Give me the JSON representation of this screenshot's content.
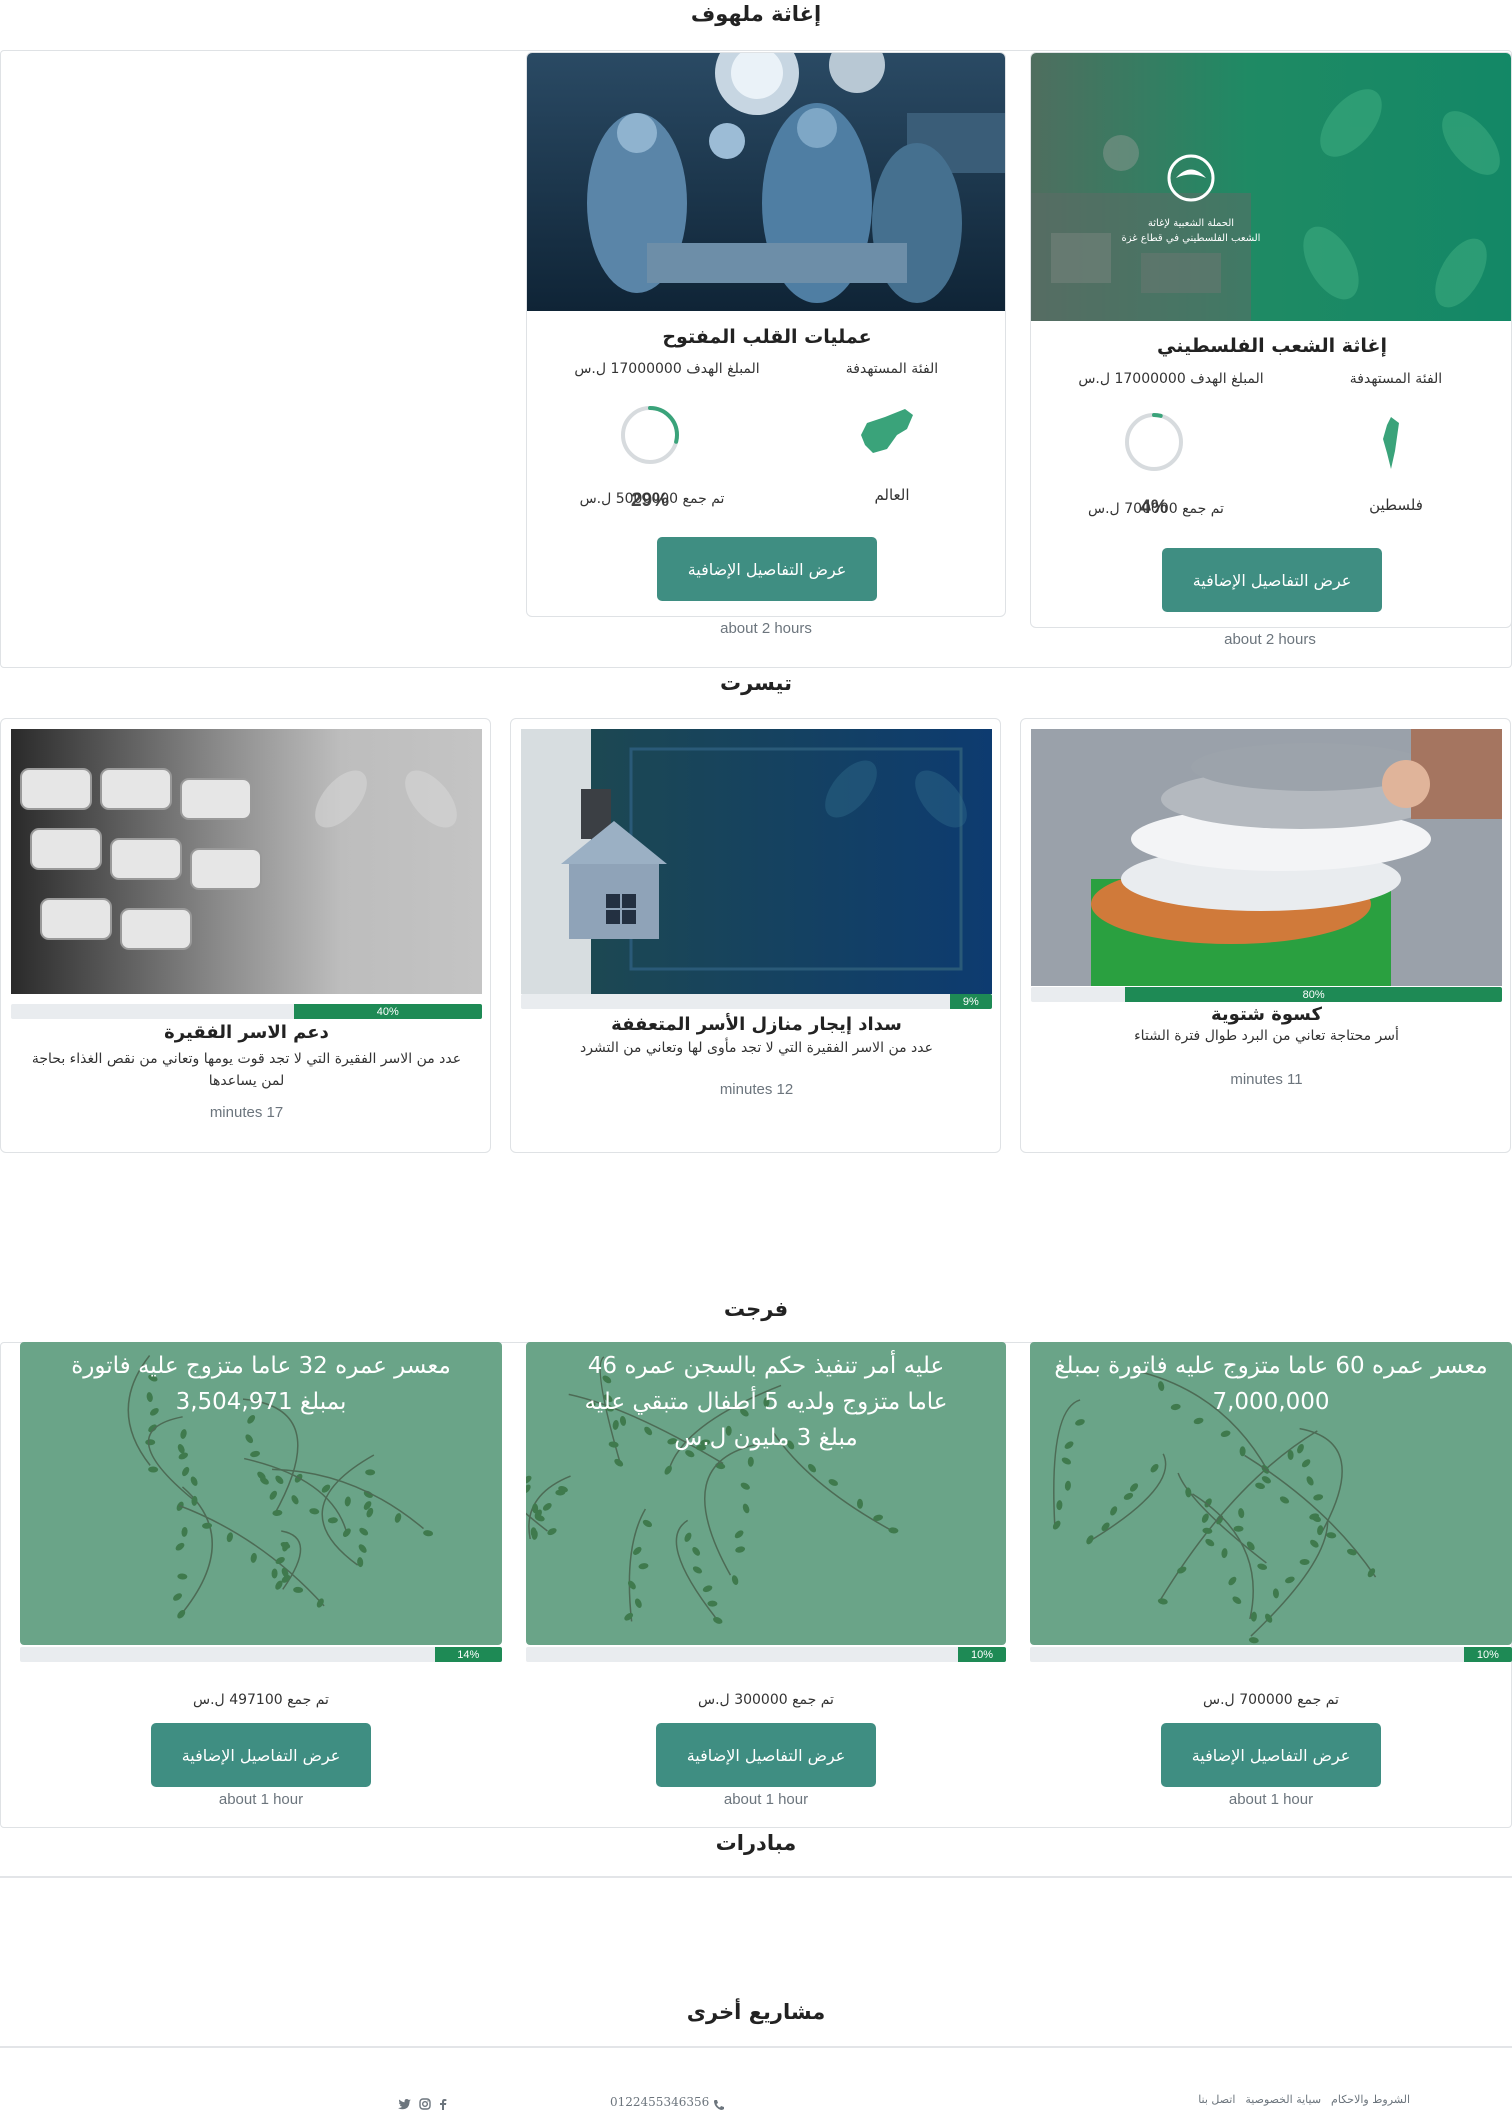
{
  "sections": {
    "urgent": {
      "title": "إغاثة ملهوف"
    },
    "tayassarat": {
      "title": "تيسرت"
    },
    "farajat": {
      "title": "فرجت"
    },
    "initiatives": {
      "title": "مبادرات"
    },
    "other": {
      "title": "مشاريع أخرى"
    }
  },
  "urgent_cards": [
    {
      "title": "إغاثة الشعب الفلسطيني",
      "image_caption_line1": "الحملة الشعبية لإغاثة",
      "image_caption_line2": "الشعب الفلسطيني في قطاع غزة",
      "target_label": "الفئة المستهدفة",
      "goal_label": "المبلغ الهدف 17000000 ل.س",
      "percent": 4,
      "percent_label": "4%",
      "region": "فلسطين",
      "collected": "تم جمع 700000 ل.س",
      "button": "عرض التفاصيل الإضافية",
      "time": "about 2 hours"
    },
    {
      "title": "عمليات القلب المفتوح",
      "target_label": "الفئة المستهدفة",
      "goal_label": "المبلغ الهدف 17000000 ل.س",
      "percent": 29,
      "percent_label": "29%",
      "region": "العالم",
      "collected": "تم جمع 5000000 ل.س",
      "button": "عرض التفاصيل الإضافية",
      "time": "about 2 hours"
    }
  ],
  "tayassarat_cards": [
    {
      "title": "كسوة شتوية",
      "desc": "أسر محتاجة تعاني من البرد طوال فترة الشتاء",
      "percent": 80,
      "percent_label": "80%",
      "time": "minutes 11"
    },
    {
      "title": "سداد إيجار منازل الأسر المتعففة",
      "desc": "عدد من الاسر الفقيرة التي لا تجد مأوى لها وتعاني من التشرد",
      "percent": 9,
      "percent_label": "9%",
      "time": "minutes 12"
    },
    {
      "title": "دعم الاسر الفقيرة",
      "desc": "عدد من الاسر الفقيرة التي لا تجد قوت يومها وتعاني من نقص الغذاء بحاجة لمن يساعدها",
      "percent": 40,
      "percent_label": "40%",
      "time": "minutes 17"
    }
  ],
  "farajat_cards": [
    {
      "overlay": "معسر عمره 60 عاما متزوج عليه فاتورة بمبلغ 7,000,000",
      "percent": 10,
      "percent_label": "10%",
      "collected": "تم جمع 700000 ل.س",
      "button": "عرض التفاصيل الإضافية",
      "time": "about 1 hour"
    },
    {
      "overlay": "عليه أمر تنفيذ حكم بالسجن عمره 46 عاما متزوج ولديه 5 أطفال متبقي عليه مبلغ 3 مليون ل.س",
      "percent": 10,
      "percent_label": "10%",
      "collected": "تم جمع 300000 ل.س",
      "button": "عرض التفاصيل الإضافية",
      "time": "about 1 hour"
    },
    {
      "overlay": "معسر عمره 32 عاما متزوج عليه فاتورة بمبلغ 3,504,971",
      "percent": 14,
      "percent_label": "14%",
      "collected": "تم جمع 497100 ل.س",
      "button": "عرض التفاصيل الإضافية",
      "time": "about 1 hour"
    }
  ],
  "footer": {
    "links": [
      "الشروط والاحكام",
      "سياية الخصوصية",
      "اتصل بنا"
    ],
    "phone": "0122455346356",
    "social": [
      "twitter-icon",
      "instagram-icon",
      "facebook-icon"
    ]
  },
  "colors": {
    "accent": "#3f8e82",
    "progress": "#1e8a55",
    "ring": "#3aa37a",
    "farajat_bg": "#6aa488"
  }
}
